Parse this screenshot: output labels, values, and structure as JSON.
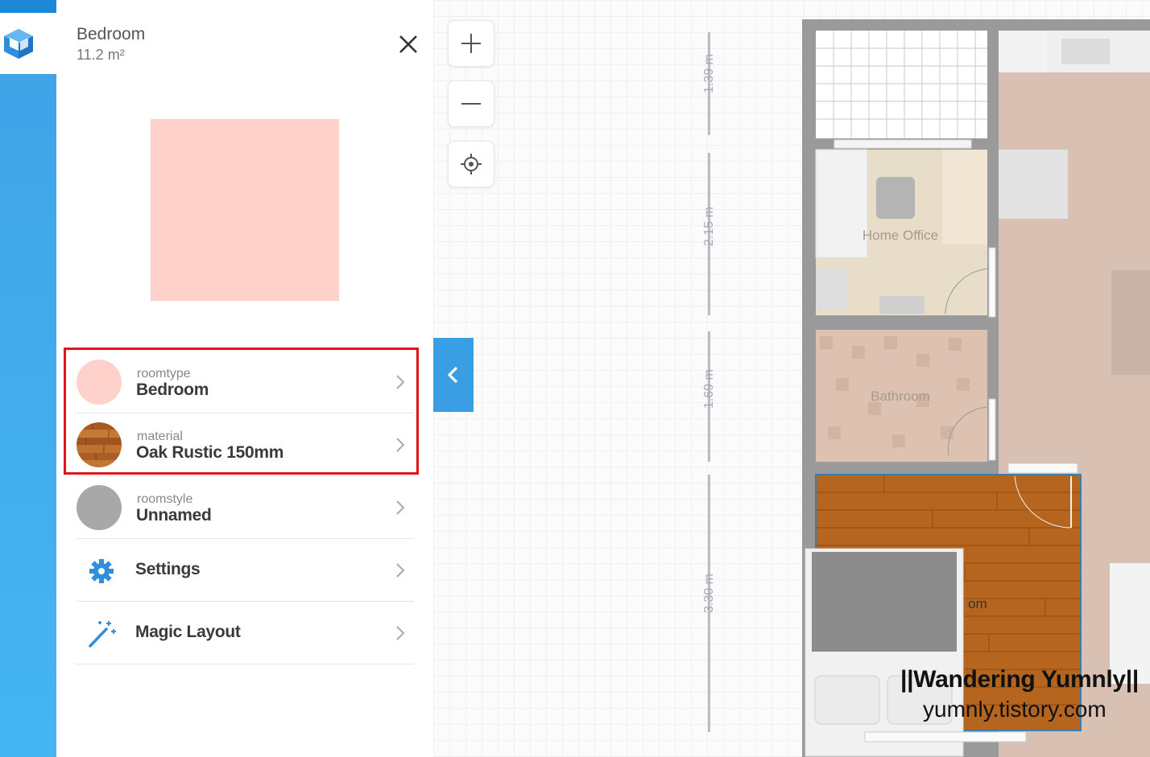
{
  "room": {
    "name": "Bedroom",
    "area": "11.2 m²",
    "preview_color": "#ffd1cb"
  },
  "properties": [
    {
      "caption": "roomtype",
      "value": "Bedroom",
      "swatch_color": "#ffd1cb"
    },
    {
      "caption": "material",
      "value": "Oak Rustic 150mm",
      "swatch": "oak-wood"
    },
    {
      "caption": "roomstyle",
      "value": "Unnamed",
      "swatch_color": "#a8a8a8"
    }
  ],
  "menu": [
    {
      "label": "Settings",
      "icon": "gear-icon"
    },
    {
      "label": "Magic Layout",
      "icon": "magic-wand-icon"
    }
  ],
  "map": {
    "zoom_in": "zoom-in-icon",
    "zoom_out": "zoom-out-icon",
    "locate": "locate-icon",
    "dimensions": [
      "1.39 m",
      "2.15 m",
      "1.69 m",
      "3.30 m"
    ],
    "rooms": [
      "Home Office",
      "Bathroom",
      "om"
    ]
  },
  "watermark": {
    "title": "||Wandering Yumnly||",
    "url": "yumnly.tistory.com"
  },
  "colors": {
    "accent": "#3a9ee4",
    "highlight": "#e0141a",
    "oak": "#b5651d"
  }
}
